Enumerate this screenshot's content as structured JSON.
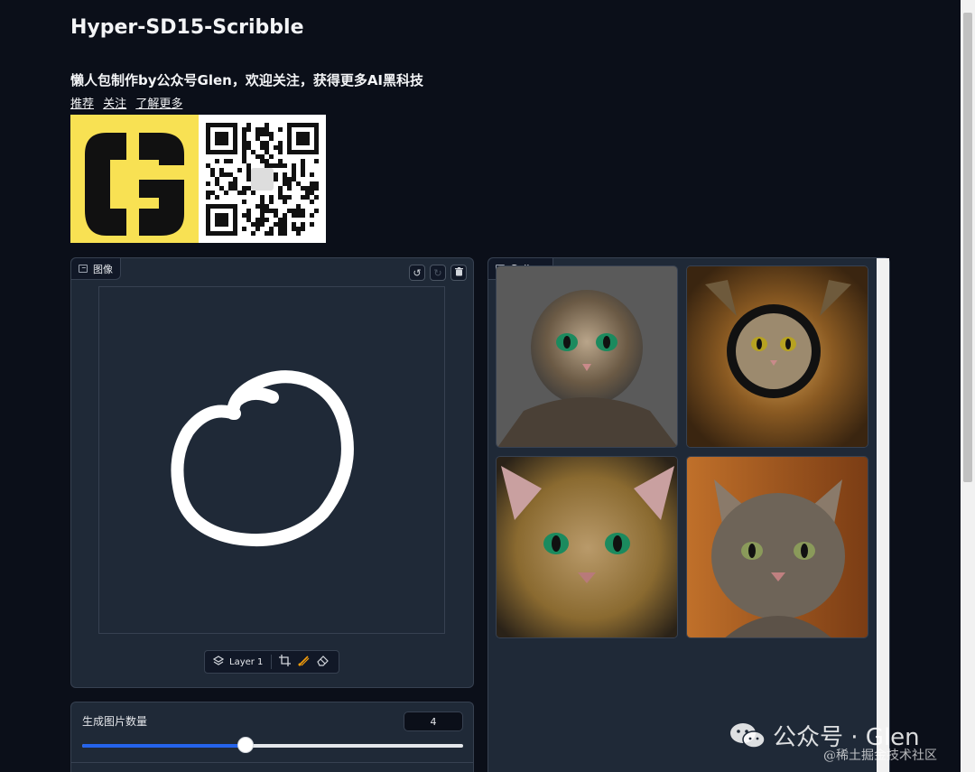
{
  "header": {
    "title": "Hyper-SD15-Scribble",
    "subtitle": "懒人包制作by公众号Glen，欢迎关注，获得更多AI黑科技",
    "links": [
      "推荐",
      "关注",
      "了解更多"
    ]
  },
  "logo": {
    "letter": "G",
    "bg_color": "#f8e153"
  },
  "image_panel": {
    "label": "图像",
    "layer_label": "Layer 1",
    "buttons": [
      "undo-icon",
      "redo-icon",
      "trash-icon"
    ]
  },
  "gallery_panel": {
    "label": "Gallery",
    "images": [
      "cat-image-1",
      "cat-image-2",
      "cat-image-3",
      "cat-image-4"
    ]
  },
  "settings": {
    "num_images_label": "生成图片数量",
    "num_images_value": "4",
    "slider_fraction": 0.43
  },
  "watermark": {
    "main": "公众号 · Glen",
    "sub": "@稀土掘金技术社区"
  },
  "colors": {
    "accent": "#2563eb",
    "background": "#0b0f19",
    "panel": "#1f2937"
  }
}
